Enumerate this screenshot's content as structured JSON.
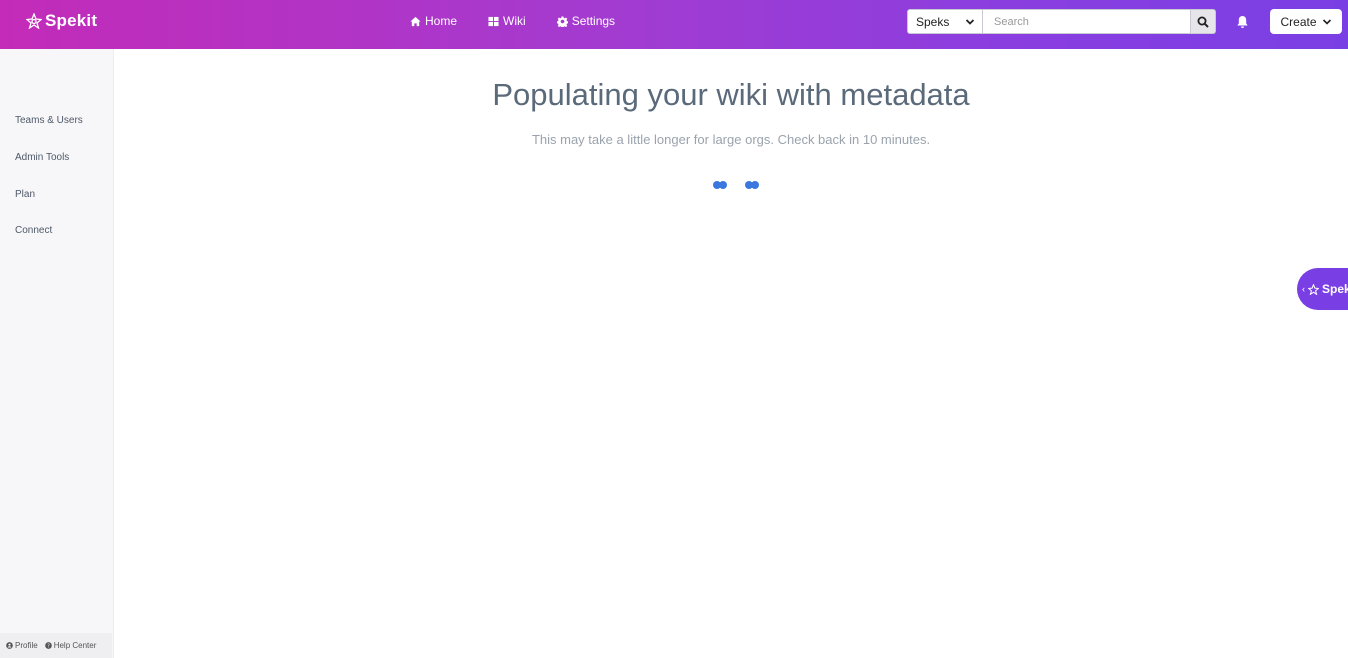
{
  "brand": {
    "name": "Spekit"
  },
  "nav": {
    "home": "Home",
    "wiki": "Wiki",
    "settings": "Settings"
  },
  "search": {
    "scope": "Speks",
    "placeholder": "Search"
  },
  "create": {
    "label": "Create"
  },
  "sidebar": {
    "items": [
      {
        "label": "Teams & Users"
      },
      {
        "label": "Admin Tools"
      },
      {
        "label": "Plan"
      },
      {
        "label": "Connect"
      }
    ],
    "footer": {
      "profile": "Profile",
      "help": "Help Center"
    }
  },
  "main": {
    "title": "Populating your wiki with metadata",
    "subtitle": "This may take a little longer for large orgs. Check back in 10 minutes."
  },
  "side_tab": {
    "label": "Spek"
  },
  "colors": {
    "accent": "#7a3fe4",
    "brand_start": "#c32bb8",
    "loader": "#3a78e0"
  }
}
